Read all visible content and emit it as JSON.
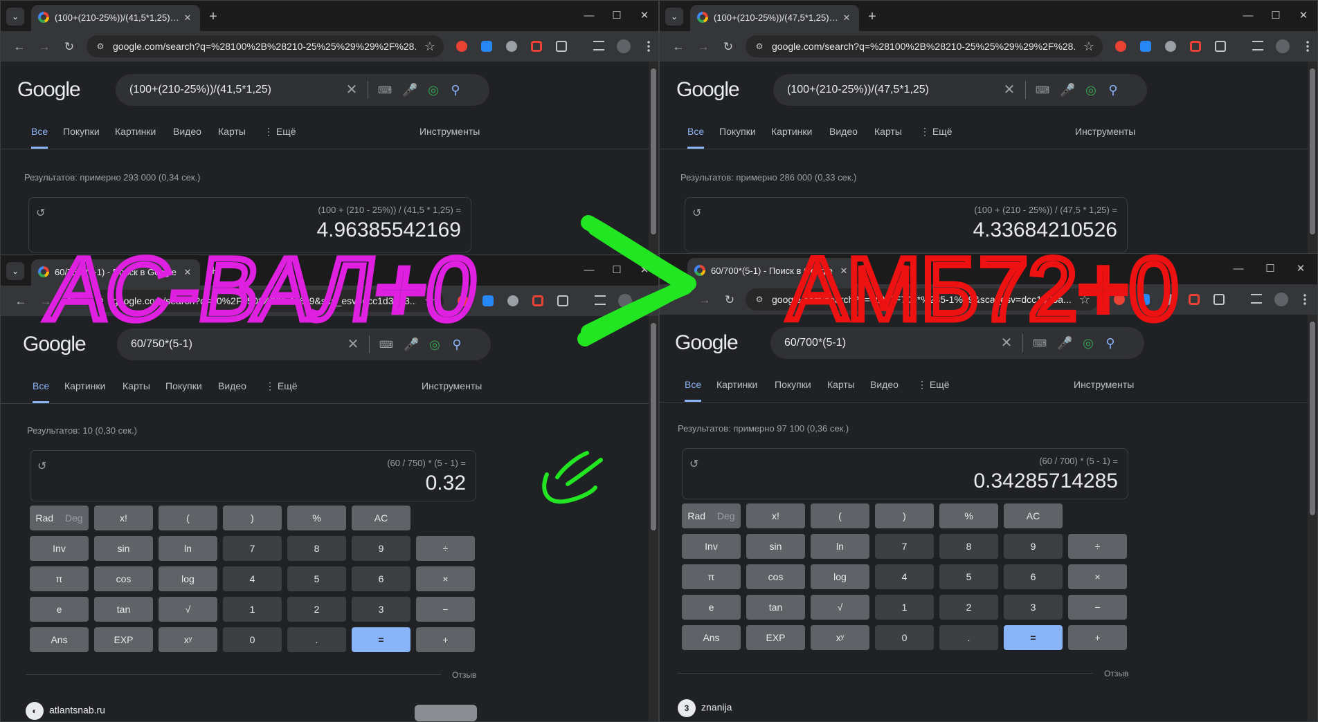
{
  "windows": [
    {
      "tab_title": "(100+(210-25%))/(41,5*1,25) - П",
      "url": "google.com/search?q=%28100%2B%28210-25%25%29%29%2F%28...",
      "query": "(100+(210-25%))/(41,5*1,25)",
      "tabs": [
        "Все",
        "Покупки",
        "Картинки",
        "Видео",
        "Карты",
        "⋮ Ещё"
      ],
      "tools": "Инструменты",
      "results": "Результатов: примерно 293 000 (0,34 сек.)",
      "expr": "(100 + (210 - 25%)) / (41,5 * 1,25) =",
      "result": "4.96385542169"
    },
    {
      "tab_title": "(100+(210-25%))/(47,5*1,25) - П",
      "url": "google.com/search?q=%28100%2B%28210-25%25%29%29%2F%28...",
      "query": "(100+(210-25%))/(47,5*1,25)",
      "tabs": [
        "Все",
        "Покупки",
        "Картинки",
        "Видео",
        "Карты",
        "⋮ Ещё"
      ],
      "tools": "Инструменты",
      "results": "Результатов: примерно 286 000 (0,33 сек.)",
      "expr": "(100 + (210 - 25%)) / (47,5 * 1,25) =",
      "result": "4.33684210526"
    },
    {
      "tab_title": "60/750*(5-1) - Поиск в Google",
      "url": "google.com/search?q=60%2F750*%285-1%29&sca_esv=dcc1d35a3...",
      "query": "60/750*(5-1)",
      "tabs": [
        "Все",
        "Картинки",
        "Карты",
        "Покупки",
        "Видео",
        "⋮ Ещё"
      ],
      "tools": "Инструменты",
      "results": "Результатов: 10 (0,30 сек.)",
      "expr": "(60 / 750) * (5 - 1) =",
      "result": "0.32",
      "feedback": "Отзыв",
      "site": "atlantsnab.ru"
    },
    {
      "tab_title": "60/700*(5-1) - Поиск в Google",
      "url": "google.com/search?q=60%2F700*%285-1%29&sca_esv=dcc1d35a...",
      "query": "60/700*(5-1)",
      "tabs": [
        "Все",
        "Картинки",
        "Покупки",
        "Карты",
        "Видео",
        "⋮ Ещё"
      ],
      "tools": "Инструменты",
      "results": "Результатов: примерно 97 100 (0,36 сек.)",
      "expr": "(60 / 700) * (5 - 1) =",
      "result": "0.34285714285",
      "feedback": "Отзыв",
      "site": "znanija"
    }
  ],
  "google_logo": "Google",
  "calc_keys": [
    [
      "Rad | Deg",
      "x!",
      "(",
      ")",
      "%",
      "AC"
    ],
    [
      "Inv",
      "sin",
      "ln",
      "7",
      "8",
      "9",
      "÷"
    ],
    [
      "π",
      "cos",
      "log",
      "4",
      "5",
      "6",
      "×"
    ],
    [
      "e",
      "tan",
      "√",
      "1",
      "2",
      "3",
      "−"
    ],
    [
      "Ans",
      "EXP",
      "xʸ",
      "0",
      ".",
      "=",
      "+"
    ]
  ],
  "rad_label": "Rad",
  "deg_label": "Deg",
  "annotations": {
    "left_text": "АС-ВАЛ+0",
    "right_text": "АМБ72+0",
    "left_color": "#e020e0",
    "right_color": "#ee1111",
    "arrow_color": "#22e622",
    "check_color": "#22e622"
  }
}
